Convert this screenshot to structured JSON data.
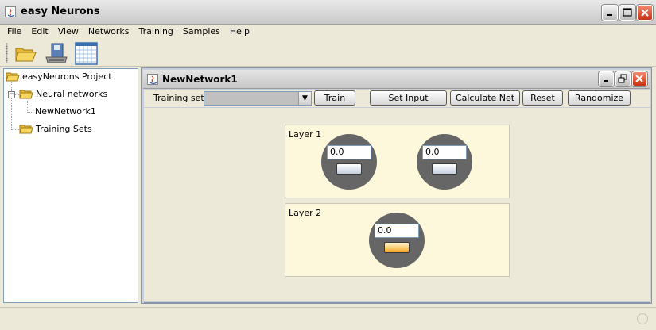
{
  "window": {
    "title": "easy Neurons"
  },
  "menu": {
    "items": [
      "File",
      "Edit",
      "View",
      "Networks",
      "Training",
      "Samples",
      "Help"
    ]
  },
  "toolbar": {
    "buttons": [
      "open-folder-icon",
      "save-disk-icon",
      "table-grid-icon"
    ]
  },
  "tree": {
    "root": "easyNeurons Project",
    "neural_networks": "Neural networks",
    "network1": "NewNetwork1",
    "training_sets": "Training Sets"
  },
  "network_frame": {
    "title": "NewNetwork1",
    "training_set_label": "Training set:",
    "training_set_value": "",
    "buttons": {
      "train": "Train",
      "set_input": "Set Input",
      "calculate": "Calculate Net",
      "reset": "Reset",
      "randomize": "Randomize"
    }
  },
  "layers": [
    {
      "label": "Layer 1",
      "neurons": [
        "0.0",
        "0.0"
      ]
    },
    {
      "label": "Layer 2",
      "neurons": [
        "0.0"
      ]
    }
  ],
  "colors": {
    "layer_bg": "#fdf8dc",
    "neuron": "#666666",
    "frame_border": "#8594a8"
  }
}
